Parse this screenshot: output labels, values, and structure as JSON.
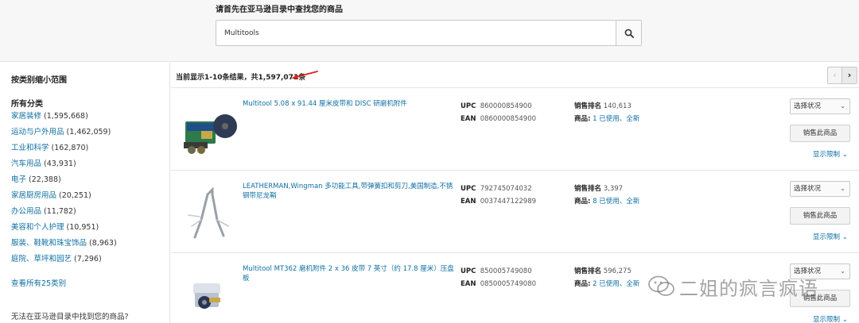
{
  "search": {
    "title": "请首先在亚马逊目录中查找您的商品",
    "value": "Multitools",
    "button_icon": "search-icon"
  },
  "sidebar": {
    "title": "按类别缩小范围",
    "all_categories": "所有分类",
    "items": [
      {
        "label": "家居装修",
        "count": "(1,595,668)"
      },
      {
        "label": "运动与户外用品",
        "count": "(1,462,059)"
      },
      {
        "label": "工业和科学",
        "count": "(162,870)"
      },
      {
        "label": "汽车用品",
        "count": "(43,931)"
      },
      {
        "label": "电子",
        "count": "(22,388)"
      },
      {
        "label": "家居厨房用品",
        "count": "(20,251)"
      },
      {
        "label": "办公用品",
        "count": "(11,782)"
      },
      {
        "label": "美容和个人护理",
        "count": "(10,951)"
      },
      {
        "label": "服装、鞋靴和珠宝饰品",
        "count": "(8,963)"
      },
      {
        "label": "庭院、草坪和园艺",
        "count": "(7,296)"
      }
    ],
    "see_all": "查看所有25类别",
    "cant_find": "无法在亚马逊目录中找到您的商品?"
  },
  "results": {
    "count_text": "当前显示1-10条结果，共1,597,071条",
    "pager_prev": "‹",
    "pager_next": "›"
  },
  "labels": {
    "upc": "UPC",
    "ean": "EAN",
    "sales_rank": "销售排名",
    "product": "商品:",
    "condition": "选择状况",
    "sell_button": "销售此商品",
    "show_limit": "显示限制"
  },
  "products": [
    {
      "title": "Multitool 5.08 x 91.44 厘米皮带和 DISC 研磨机附件",
      "upc": "860000854900",
      "ean": "0860000854900",
      "rank": "140,613",
      "offers": "1 已使用、全新"
    },
    {
      "title": "LEATHERMAN,Wingman 多功能工具,带弹簧扣和剪刀,美国制造,不锈钢带尼龙鞘",
      "upc": "792745074032",
      "ean": "0037447122989",
      "rank": "3,397",
      "offers": "8 已使用、全新"
    },
    {
      "title": "Multitool MT362 磨机附件 2 x 36 皮带 7 英寸（约 17.8 厘米）压盘板",
      "upc": "850005749080",
      "ean": "0850005749080",
      "rank": "596,275",
      "offers": "2 已使用、全新"
    }
  ],
  "watermark": {
    "text": "二姐的疯言疯语",
    "icon": "wechat-icon"
  },
  "colors": {
    "link": "#0f6fa3",
    "arrow": "#e02020"
  }
}
